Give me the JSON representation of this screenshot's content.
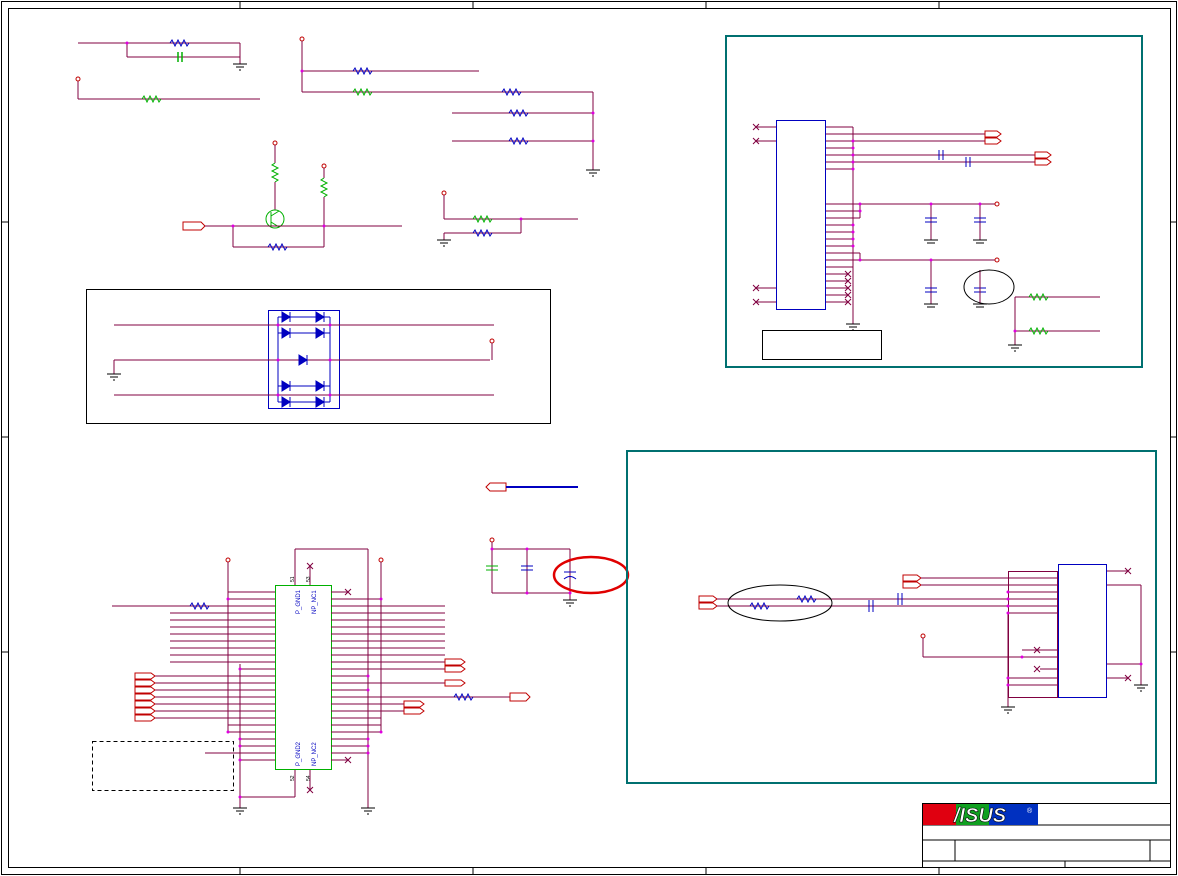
{
  "colors": {
    "wire": "#800040",
    "net": "#c00000",
    "part": "#0000c0",
    "frame": "#000000",
    "box_teal": "#007070",
    "green": "#00b000",
    "highlight": "#e00000",
    "junction": "#e000e0"
  },
  "connector_left": {
    "pin_labels": [
      "P_GND1",
      "NP_NC1",
      "P_GND2",
      "NP_NC2"
    ],
    "pin_numbers": [
      "51",
      "53",
      "52",
      "54"
    ]
  },
  "title_block": {
    "logo_text": "/ISUS",
    "registered_mark": "®"
  }
}
